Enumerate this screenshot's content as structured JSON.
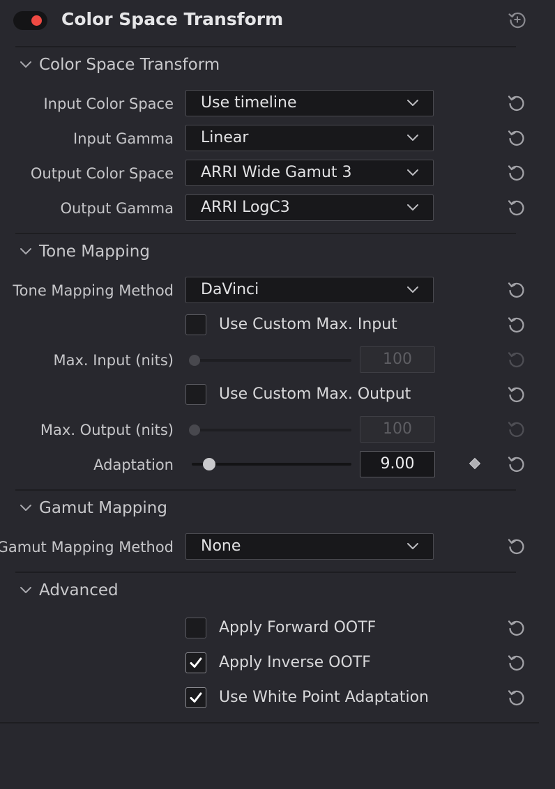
{
  "header": {
    "title": "Color Space Transform",
    "enabled": true,
    "accent_color": "#ef4a43"
  },
  "sections": {
    "cst": {
      "title": "Color Space Transform",
      "expanded": true
    },
    "tone": {
      "title": "Tone Mapping",
      "expanded": true
    },
    "gamut": {
      "title": "Gamut Mapping",
      "expanded": true
    },
    "advanced": {
      "title": "Advanced",
      "expanded": true
    }
  },
  "fields": {
    "input_color_space": {
      "label": "Input Color Space",
      "value": "Use timeline"
    },
    "input_gamma": {
      "label": "Input Gamma",
      "value": "Linear"
    },
    "output_color_space": {
      "label": "Output Color Space",
      "value": "ARRI Wide Gamut 3"
    },
    "output_gamma": {
      "label": "Output Gamma",
      "value": "ARRI LogC3"
    },
    "tone_mapping_method": {
      "label": "Tone Mapping Method",
      "value": "DaVinci"
    },
    "use_custom_max_input": {
      "label": "Use Custom Max. Input",
      "checked": false
    },
    "max_input": {
      "label": "Max. Input (nits)",
      "value": "100",
      "enabled": false,
      "slider_fraction": 0.0
    },
    "use_custom_max_output": {
      "label": "Use Custom Max. Output",
      "checked": false
    },
    "max_output": {
      "label": "Max. Output (nits)",
      "value": "100",
      "enabled": false,
      "slider_fraction": 0.0
    },
    "adaptation": {
      "label": "Adaptation",
      "value": "9.00",
      "enabled": true,
      "slider_fraction": 0.09
    },
    "gamut_mapping_method": {
      "label": "Gamut Mapping Method",
      "value": "None"
    },
    "apply_forward_ootf": {
      "label": "Apply Forward OOTF",
      "checked": false
    },
    "apply_inverse_ootf": {
      "label": "Apply Inverse OOTF",
      "checked": true
    },
    "use_white_point_adaptation": {
      "label": "Use White Point Adaptation",
      "checked": true
    }
  },
  "icons": {
    "header_reset": "reset-plus-icon",
    "reset": "reset-icon",
    "chevron": "chevron-down-icon",
    "keyframe": "keyframe-diamond-icon",
    "check": "checkmark-icon"
  }
}
